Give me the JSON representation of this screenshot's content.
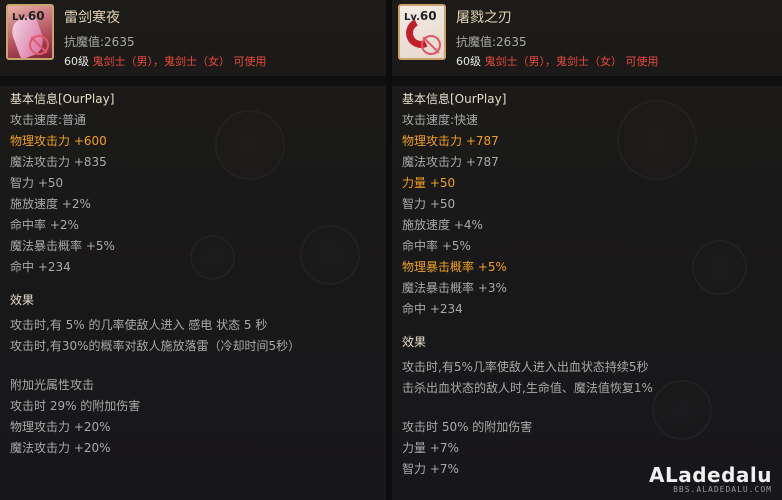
{
  "left": {
    "level_label": "Lv.",
    "level": "60",
    "name": "雷剑寒夜",
    "resist": "抗魔值:2635",
    "req_level": "60级",
    "req_classes": "鬼剑士（男），鬼剑士（女）",
    "req_suffix": "可使用",
    "section_basic": "基本信息[OurPlay]",
    "stats": [
      {
        "text": "攻击速度:普通"
      },
      {
        "text": "物理攻击力 +600"
      },
      {
        "text": "魔法攻击力 +835"
      },
      {
        "text": "智力 +50"
      },
      {
        "text": "施放速度 +2%"
      },
      {
        "text": "命中率 +2%"
      },
      {
        "text": "魔法暴击概率 +5%"
      },
      {
        "text": "命中 +234"
      }
    ],
    "section_effect": "效果",
    "effects": [
      "攻击时,有 5% 的几率使敌人进入 感电 状态 5 秒",
      "攻击时,有30%的概率对敌人施放落雷（冷却时间5秒）"
    ],
    "extra_title": "附加光属性攻击",
    "extra": [
      "攻击时 29% 的附加伤害",
      "物理攻击力 +20%",
      "魔法攻击力 +20%"
    ]
  },
  "right": {
    "level_label": "Lv.",
    "level": "60",
    "name": "屠戮之刃",
    "resist": "抗魔值:2635",
    "req_level": "60级",
    "req_classes": "鬼剑士（男），鬼剑士（女）",
    "req_suffix": "可使用",
    "section_basic": "基本信息[OurPlay]",
    "stats": [
      {
        "text": "攻击速度:快速"
      },
      {
        "text": "物理攻击力 +787"
      },
      {
        "text": "魔法攻击力 +787"
      },
      {
        "text": "力量 +50"
      },
      {
        "text": "智力 +50"
      },
      {
        "text": "施放速度 +4%"
      },
      {
        "text": "命中率 +5%"
      },
      {
        "text": "物理暴击概率 +5%"
      },
      {
        "text": "魔法暴击概率 +3%"
      },
      {
        "text": "命中 +234"
      }
    ],
    "section_effect": "效果",
    "effects": [
      "攻击时,有5%几率使敌人进入出血状态持续5秒",
      "击杀出血状态的敌人时,生命值、魔法值恢复1%"
    ],
    "extra": [
      "攻击时 50% 的附加伤害",
      "力量 +7%",
      "智力 +7%"
    ]
  },
  "watermark": {
    "brand": "ALadedalu",
    "sub": "BBS.ALADEDALU.COM"
  },
  "colors": {
    "highlight": "#f0a020",
    "class_red": "#e84a3c",
    "frame_gold": "#c9a46a"
  },
  "icons": {
    "left": "sword-item-icon",
    "right": "claw-blade-item-icon",
    "restriction": "no-sign-icon"
  }
}
